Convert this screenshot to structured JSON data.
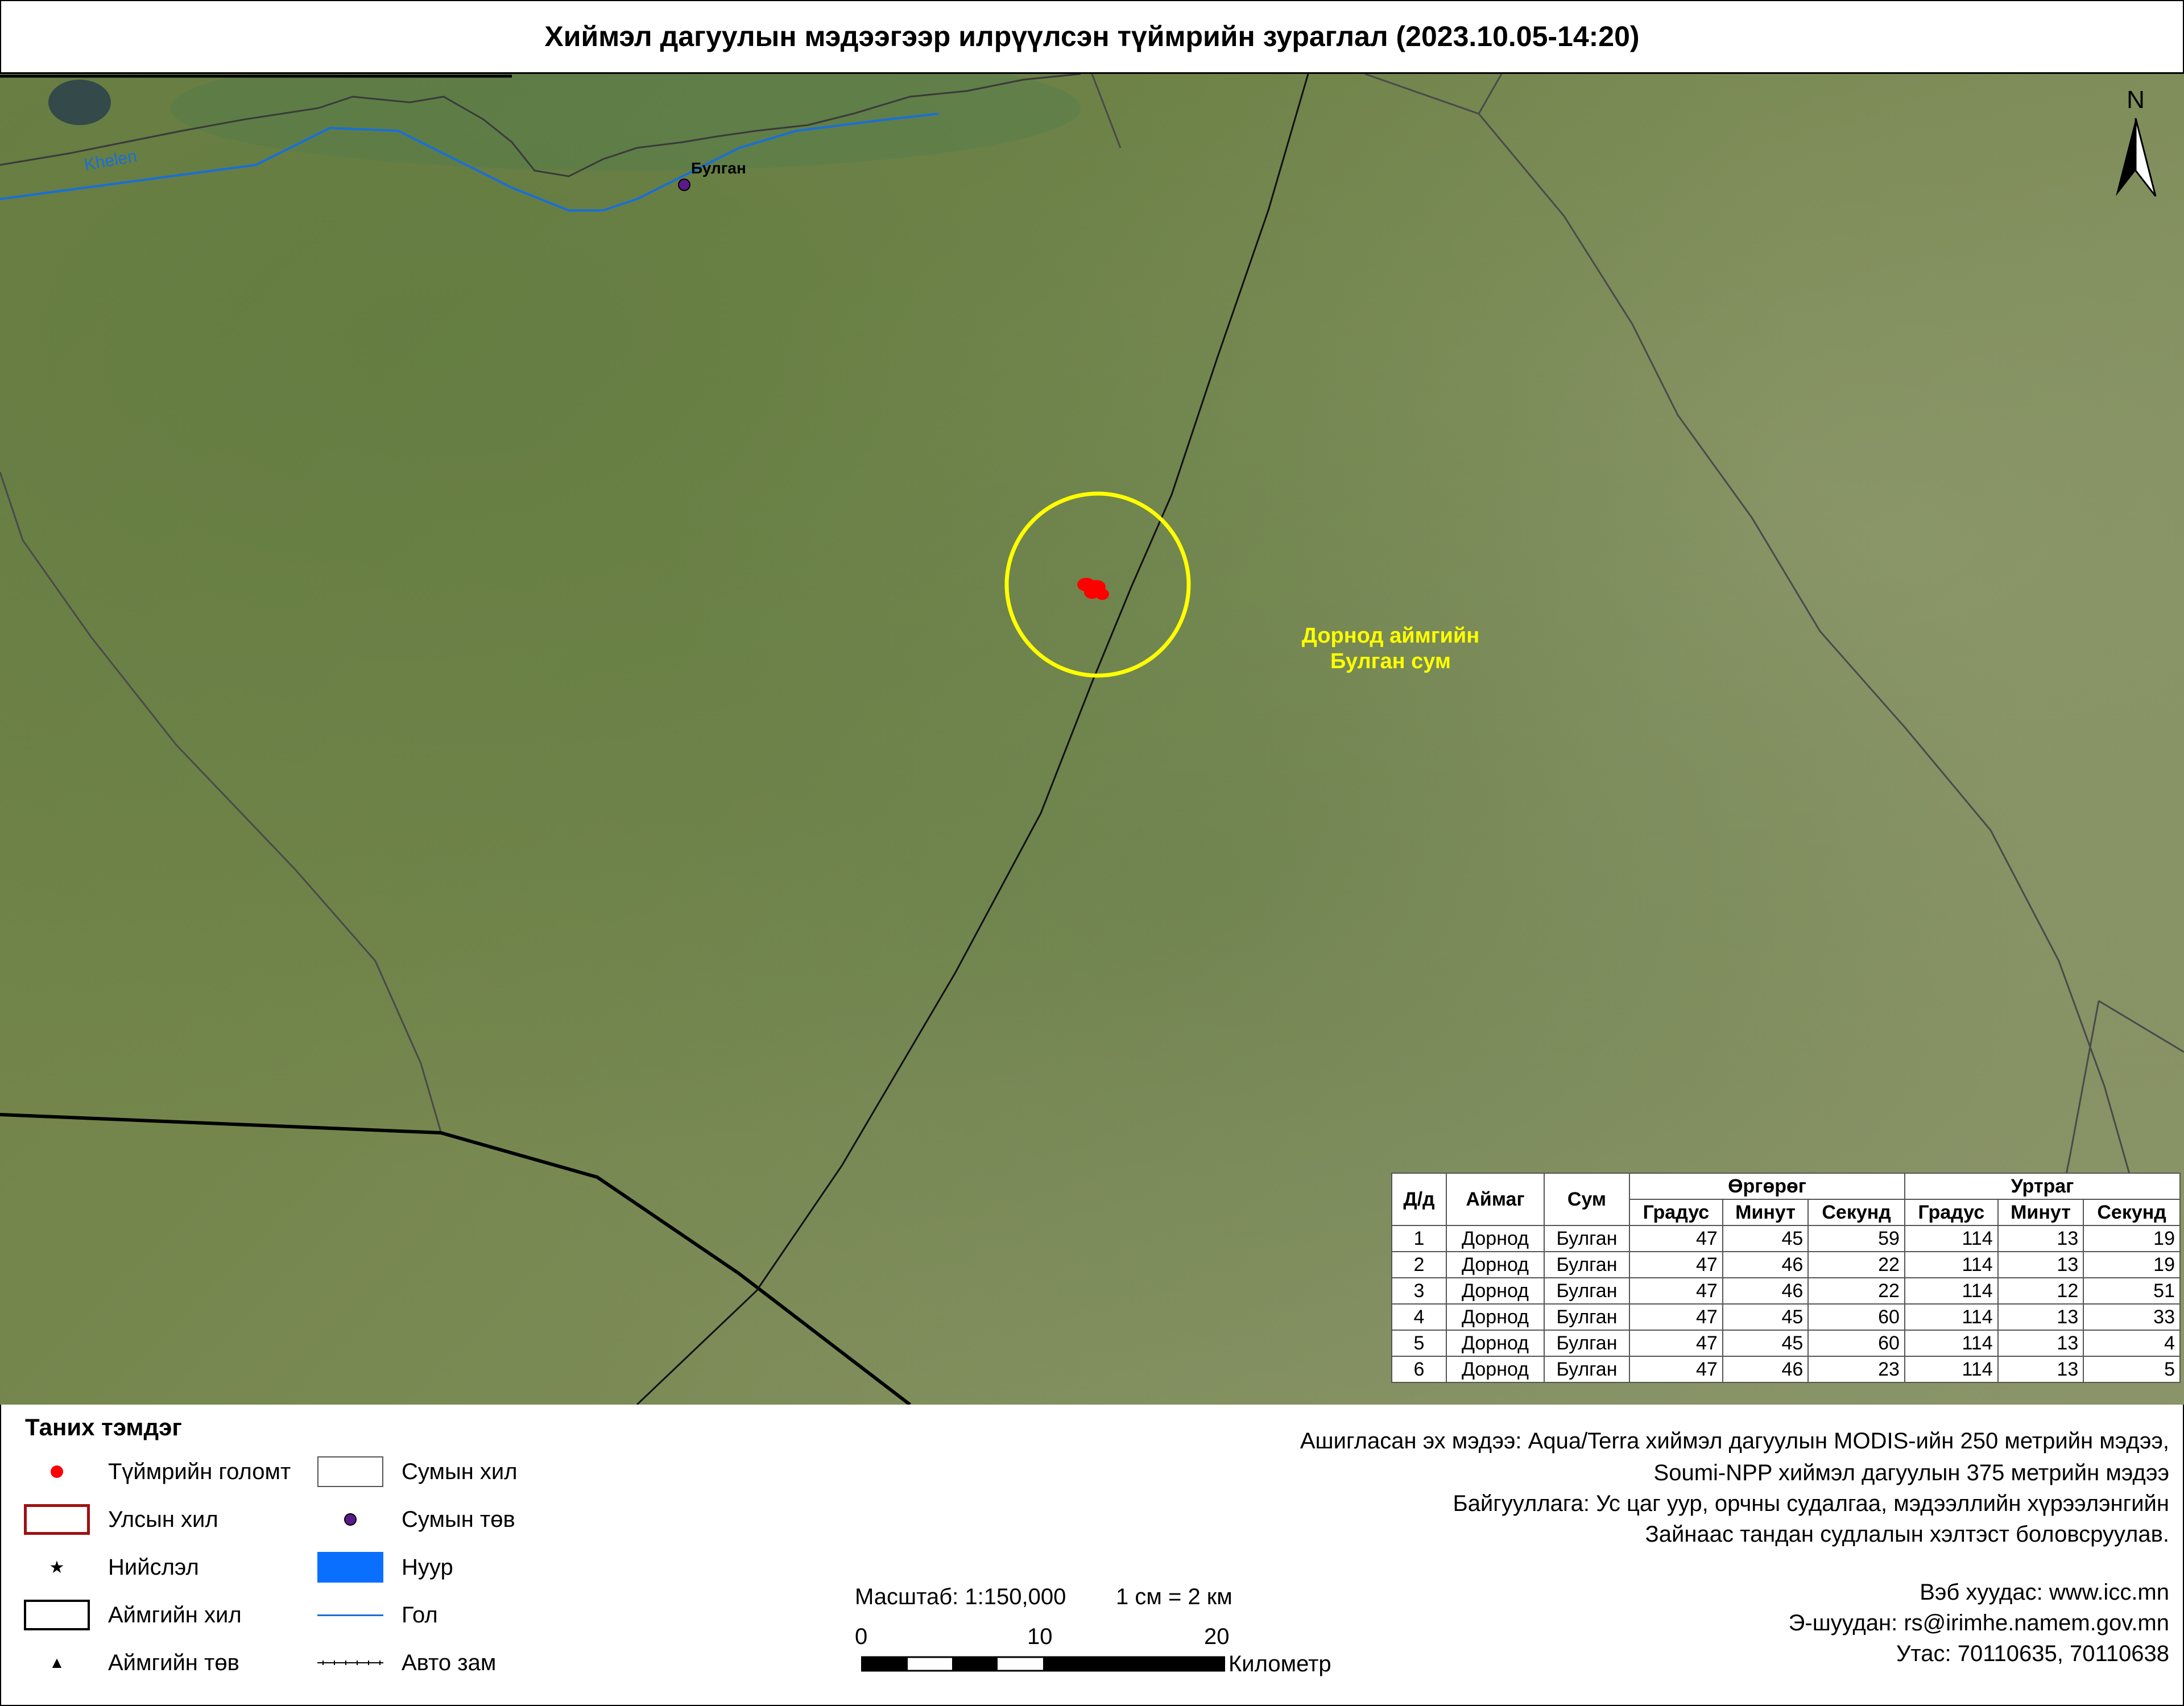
{
  "title": "Хиймэл дагуулын мэдээгээр илрүүлсэн түймрийн зураглал (2023.10.05-14:20)",
  "map": {
    "river_label": "Khelen",
    "settlement_label": "Булган",
    "region_label_line1": "Дорнод аймгийн",
    "region_label_line2": "Булган сум",
    "north_label": "N",
    "colors": {
      "fire": "#ff0000",
      "highlight_circle": "#ffff00",
      "river": "#1a6fd6",
      "region_label": "#ffff00",
      "settlement": "#5a1a8a"
    }
  },
  "fire_table": {
    "headers": {
      "num": "Д/д",
      "aimag": "Аймаг",
      "sum": "Сум",
      "lat": "Өргөрөг",
      "lon": "Уртраг"
    },
    "subheaders": [
      "Градус",
      "Минут",
      "Секунд",
      "Градус",
      "Минут",
      "Секунд"
    ],
    "rows": [
      [
        "1",
        "Дорнод",
        "Булган",
        "47",
        "45",
        "59",
        "114",
        "13",
        "19"
      ],
      [
        "2",
        "Дорнод",
        "Булган",
        "47",
        "46",
        "22",
        "114",
        "13",
        "19"
      ],
      [
        "3",
        "Дорнод",
        "Булган",
        "47",
        "46",
        "22",
        "114",
        "12",
        "51"
      ],
      [
        "4",
        "Дорнод",
        "Булган",
        "47",
        "45",
        "60",
        "114",
        "13",
        "33"
      ],
      [
        "5",
        "Дорнод",
        "Булган",
        "47",
        "45",
        "60",
        "114",
        "13",
        "4"
      ],
      [
        "6",
        "Дорнод",
        "Булган",
        "47",
        "46",
        "23",
        "114",
        "13",
        "5"
      ]
    ]
  },
  "legend": {
    "title": "Таних тэмдэг",
    "items": {
      "fire": "Түймрийн голомт",
      "national_border": "Улсын хил",
      "capital": "Нийслэл",
      "aimag_border": "Аймгийн хил",
      "aimag_center": "Аймгийн төв",
      "sum_border": "Сумын хил",
      "sum_center": "Сумын төв",
      "lake": "Нуур",
      "river": "Гол",
      "road": "Авто зам"
    }
  },
  "scale": {
    "scale_text": "Масштаб: 1:150,000",
    "ratio_text": "1 см = 2 км",
    "ticks": [
      "0",
      "10",
      "20"
    ],
    "unit": "Километр"
  },
  "source": {
    "line1": "Ашигласан эх мэдээ: Aqua/Terra хиймэл дагуулын MODIS-ийн 250 метрийн мэдээ,",
    "line2": "Soumi-NPP хиймэл дагуулын 375 метрийн мэдээ",
    "line3": "Байгууллага: Ус цаг уур, орчны судалгаа, мэдээллийн хүрээлэнгийн",
    "line4": "Зайнаас тандан судлалын хэлтэст боловсруулав."
  },
  "contact": {
    "web": "Вэб хуудас: www.icc.mn",
    "email": "Э-шуудан: rs@irimhe.namem.gov.mn",
    "phone": "Утас: 70110635, 70110638"
  }
}
